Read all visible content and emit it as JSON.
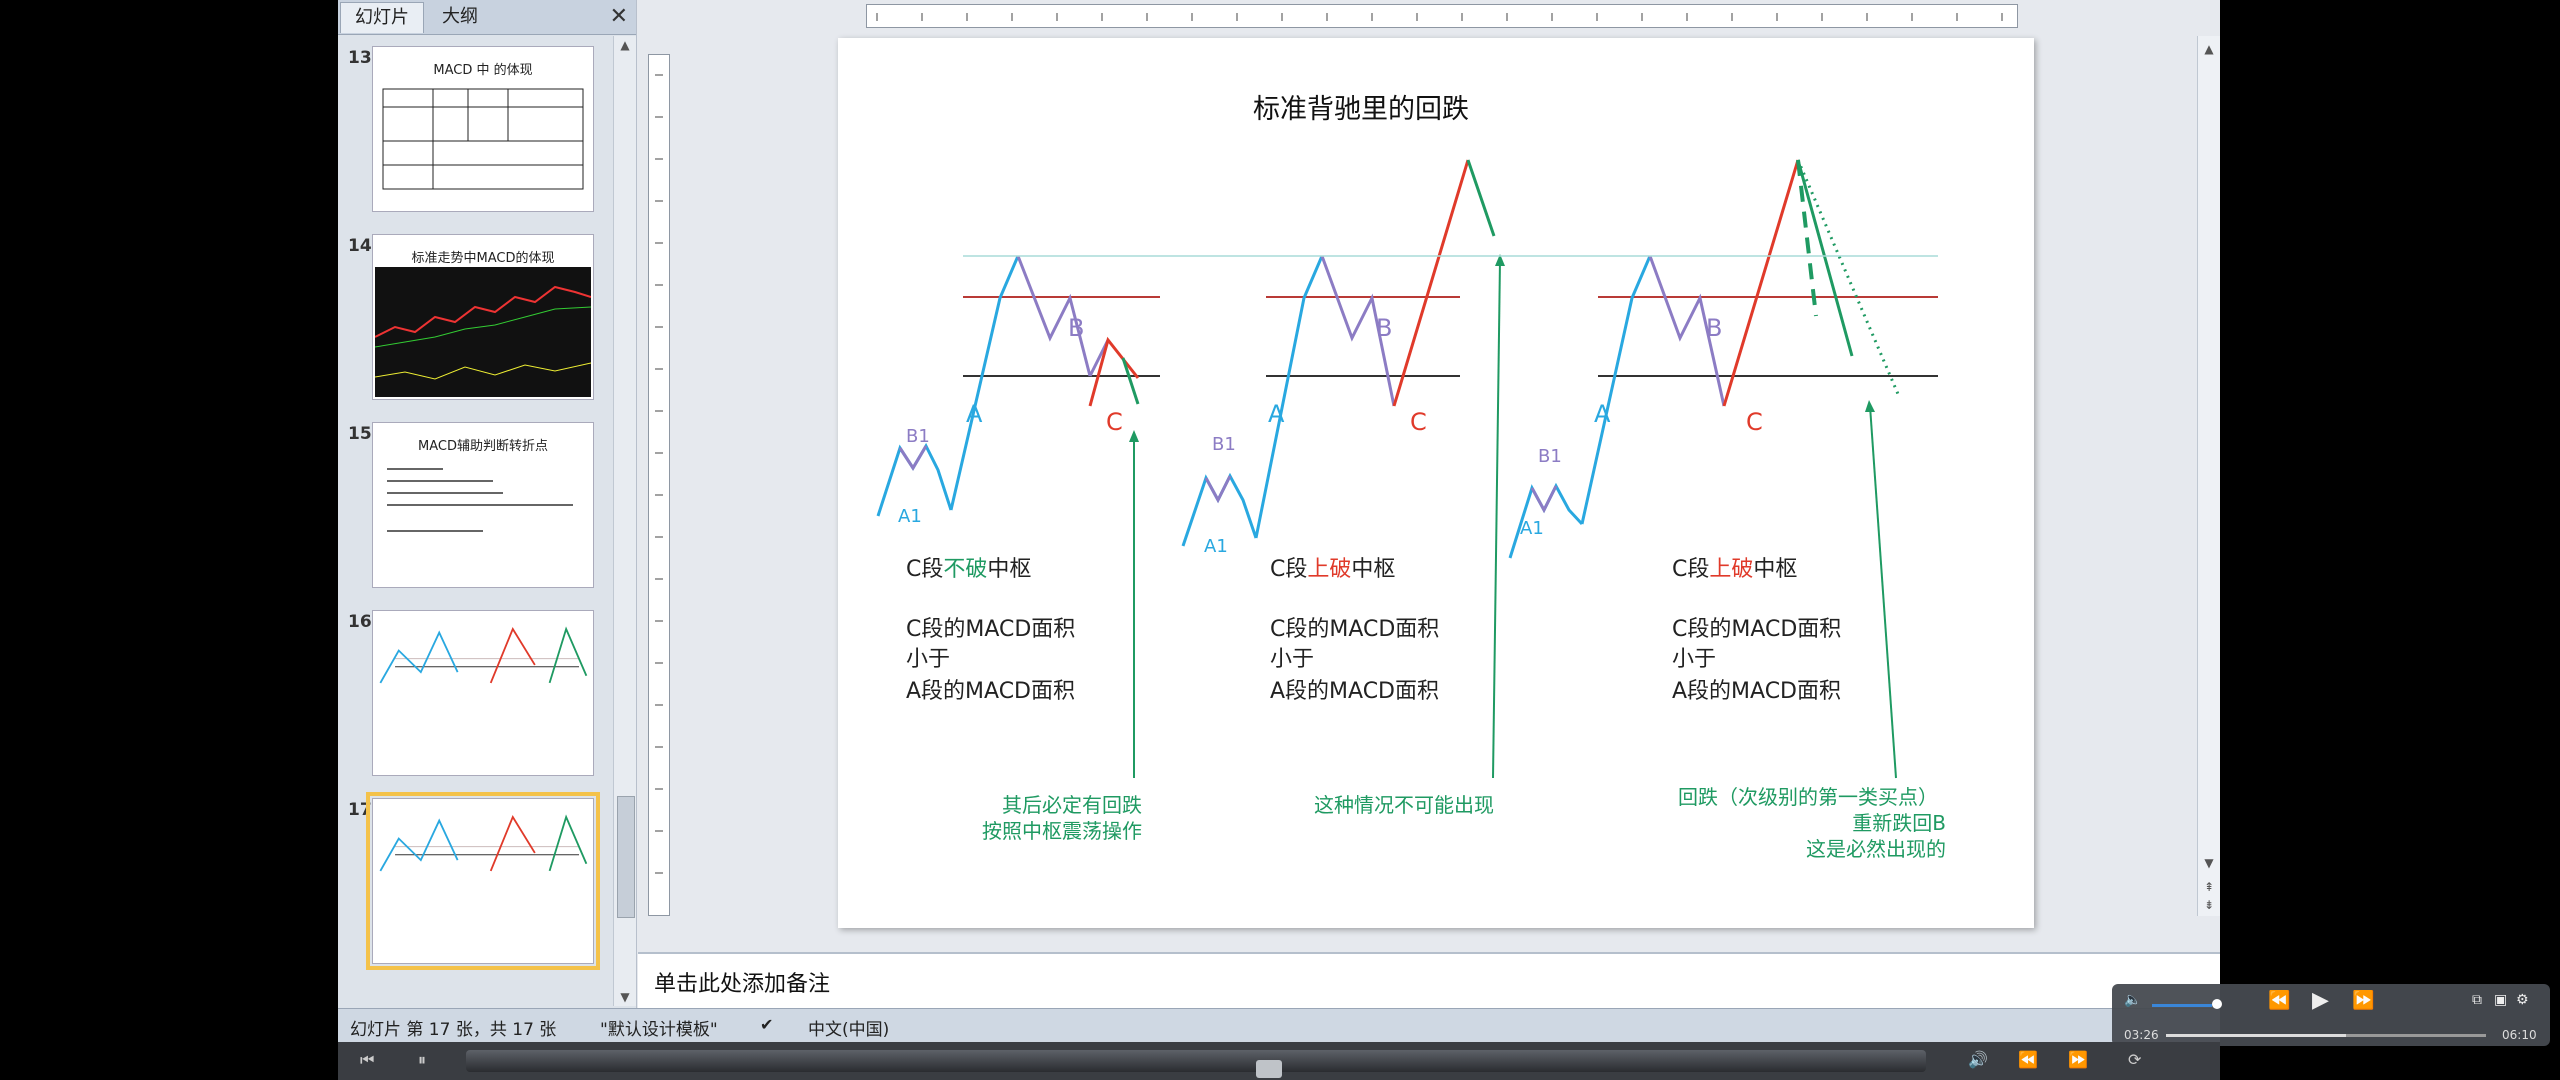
{
  "left_panel": {
    "tabs": [
      "幻灯片",
      "大纲"
    ],
    "close_glyph": "✕",
    "thumbnails": [
      {
        "number": "13",
        "title": "MACD 中 的体现"
      },
      {
        "number": "14",
        "title": "标准走势中MACD的体现"
      },
      {
        "number": "15",
        "title": "MACD辅助判断转折点"
      },
      {
        "number": "16",
        "title": ""
      },
      {
        "number": "17",
        "title": ""
      }
    ]
  },
  "slide": {
    "title": "标准背驰里的回跌",
    "labels": {
      "a1": "A1",
      "b1": "B1",
      "a": "A",
      "b": "B",
      "c": "C"
    },
    "panels": [
      {
        "case_pre": "C段",
        "case_key": "不破",
        "case_post": "中枢",
        "line1": "C段的MACD面积",
        "line2": "小于",
        "line3": "A段的MACD面积",
        "note": [
          "其后必定有回跌",
          "按照中枢震荡操作"
        ]
      },
      {
        "case_pre": "C段",
        "case_key": "上破",
        "case_post": "中枢",
        "line1": "C段的MACD面积",
        "line2": "小于",
        "line3": "A段的MACD面积",
        "note": [
          "这种情况不可能出现"
        ]
      },
      {
        "case_pre": "C段",
        "case_key": "上破",
        "case_post": "中枢",
        "line1": "C段的MACD面积",
        "line2": "小于",
        "line3": "A段的MACD面积",
        "note": [
          "回跌（次级别的第一类买点）",
          "重新跌回B",
          "这是必然出现的"
        ]
      }
    ],
    "colors": {
      "cyan": "#29a8e0",
      "purple": "#8c7cc4",
      "red": "#e03a2a",
      "green": "#1f9a62",
      "dark_red": "#b93a36"
    }
  },
  "notes": {
    "placeholder": "单击此处添加备注"
  },
  "status_bar": {
    "slide_info": "幻灯片 第 17 张，共 17 张",
    "template": "\"默认设计模板\"",
    "language": "中文(中国)"
  },
  "player": {
    "current_time": "03:26",
    "total_time": "06:10"
  }
}
